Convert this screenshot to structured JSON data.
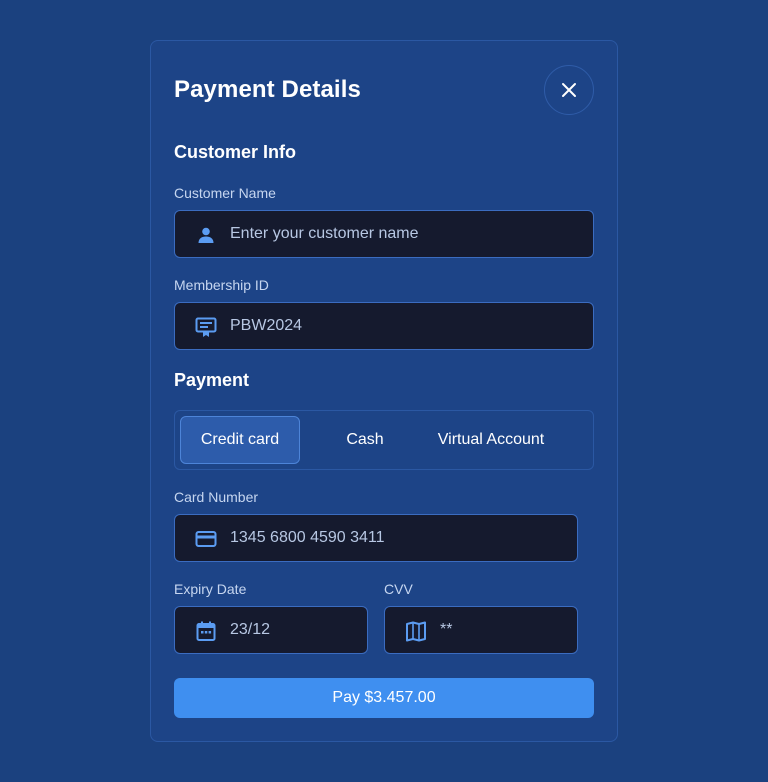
{
  "modal": {
    "title": "Payment Details"
  },
  "customer_info": {
    "heading": "Customer Info",
    "name_label": "Customer Name",
    "name_placeholder": "Enter your customer name",
    "name_value": "",
    "membership_label": "Membership ID",
    "membership_value": "PBW2024"
  },
  "payment": {
    "heading": "Payment",
    "tabs": [
      {
        "label": "Credit card",
        "active": true
      },
      {
        "label": "Cash",
        "active": false
      },
      {
        "label": "Virtual Account",
        "active": false
      }
    ],
    "card_number_label": "Card Number",
    "card_number_value": "1345 6800 4590 3411",
    "expiry_label": "Expiry Date",
    "expiry_value": "23/12",
    "cvv_label": "CVV",
    "cvv_value": "**",
    "pay_button_label": "Pay $3.457.00"
  },
  "icons": {
    "close": "close-icon",
    "user": "user-icon",
    "membership": "membership-card-icon",
    "card": "credit-card-icon",
    "calendar": "calendar-icon",
    "cvv": "security-code-icon"
  },
  "colors": {
    "background": "#1b417f",
    "modal": "#1d4487",
    "input_background": "#151a2e",
    "accent": "#3f8ff0",
    "icon": "#5b9cf2"
  }
}
